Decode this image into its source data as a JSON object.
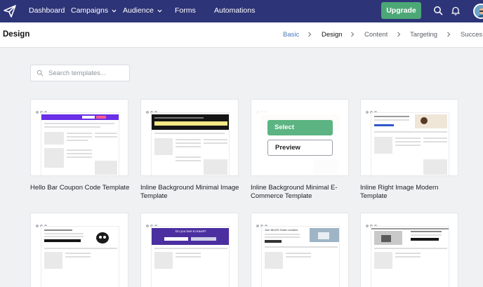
{
  "nav": {
    "items": [
      {
        "label": "Dashboard",
        "has_menu": false
      },
      {
        "label": "Campaigns",
        "has_menu": true
      },
      {
        "label": "Audience",
        "has_menu": true
      },
      {
        "label": "Forms",
        "has_menu": false
      },
      {
        "label": "Automations",
        "has_menu": false
      }
    ],
    "upgrade_label": "Upgrade",
    "colors": {
      "bar": "#2d3477",
      "upgrade": "#4ca776"
    }
  },
  "header": {
    "title": "Design",
    "breadcrumb": [
      {
        "label": "Basic",
        "state": "link"
      },
      {
        "label": "Design",
        "state": "current"
      },
      {
        "label": "Content",
        "state": "default"
      },
      {
        "label": "Targeting",
        "state": "default"
      },
      {
        "label": "Succes",
        "state": "default"
      }
    ]
  },
  "search": {
    "placeholder": "Search templates...",
    "value": ""
  },
  "hover_card": {
    "select_label": "Select",
    "preview_label": "Preview"
  },
  "templates": [
    {
      "title": "Hello Bar Coupon Code Template",
      "banner_color": "#6a2fe6"
    },
    {
      "title": "Inline Background Minimal Image Template",
      "banner_color": "#151515"
    },
    {
      "title": "Inline Background Minimal E-Commerce Template",
      "banner_color": "#f6e3de"
    },
    {
      "title": "Inline Right Image Modern Template",
      "banner_color": "#ffffff"
    },
    {
      "title": "",
      "banner_color": "#ffffff"
    },
    {
      "title": "",
      "banner_color": "#4b2fa0",
      "thumb_heading": "Do you love to travel?"
    },
    {
      "title": "",
      "banner_color": "#ffffff",
      "thumb_heading": "Join 88,000 Sales Leaders"
    },
    {
      "title": "",
      "banner_color": "#ffffff"
    }
  ]
}
